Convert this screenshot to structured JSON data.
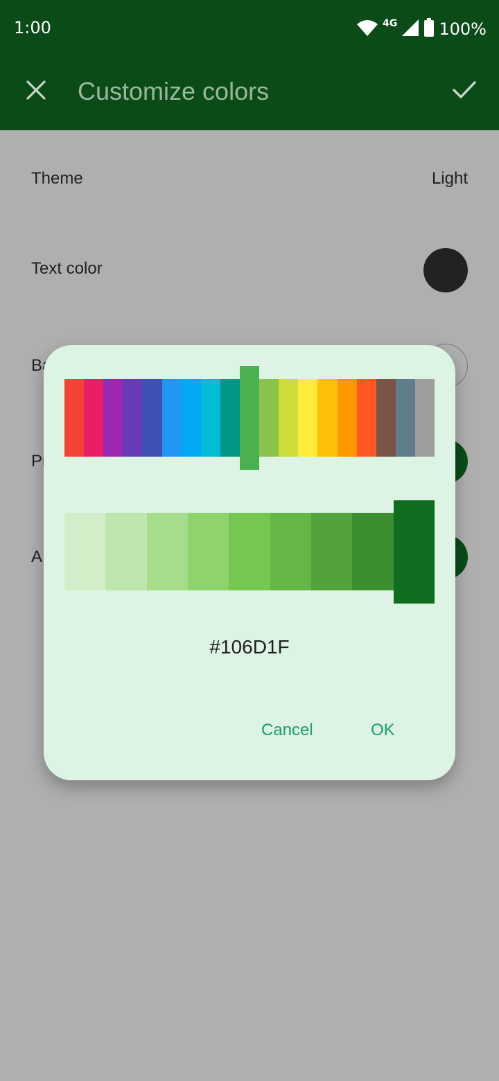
{
  "status_bar": {
    "time": "1:00",
    "network": "4G",
    "battery": "100%"
  },
  "toolbar": {
    "title": "Customize colors",
    "close_icon": "close-icon",
    "confirm_icon": "check-icon"
  },
  "settings": {
    "theme_label": "Theme",
    "theme_value": "Light",
    "text_color_label": "Text color",
    "text_color_swatch": "#222222",
    "row3_label_visible": "Ba",
    "row4_label_visible": "Pr",
    "row5_label_visible": "A",
    "row4_swatch": "#0b4b17",
    "row5_swatch": "#0b4b17"
  },
  "dialog": {
    "hue_colors": [
      "#f44336",
      "#e91e63",
      "#9c27b0",
      "#673ab7",
      "#3f51b5",
      "#2196f3",
      "#03a9f4",
      "#00bcd4",
      "#009688",
      "#4caf50",
      "#8bc34a",
      "#cddc39",
      "#ffeb3b",
      "#ffc107",
      "#ff9800",
      "#ff5722",
      "#795548",
      "#607d8b",
      "#9e9e9e"
    ],
    "selected_hue_index": 9,
    "shade_colors": [
      "#d4edc9",
      "#bfe6ac",
      "#a5dd8a",
      "#8fd36c",
      "#76c652",
      "#64b746",
      "#51a33a",
      "#3c8f30",
      "#106d1f"
    ],
    "selected_shade_index": 8,
    "hex_value": "#106D1F",
    "cancel_label": "Cancel",
    "ok_label": "OK"
  },
  "colors": {
    "toolbar_bg": "#0b4b17",
    "dialog_bg": "#ddf4e4",
    "accent": "#1aa06a",
    "scrim": "#afafaf"
  }
}
